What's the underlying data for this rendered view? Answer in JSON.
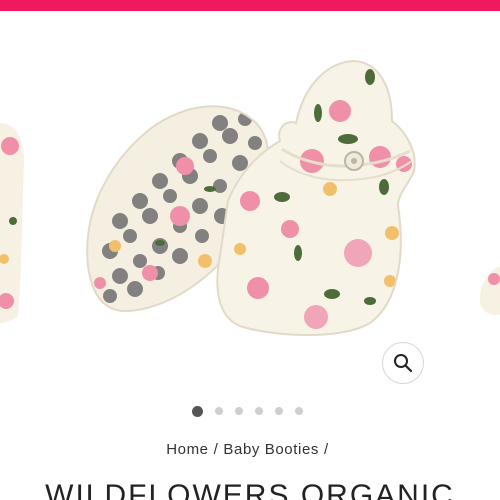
{
  "top_bar": {
    "color": "#f0185e"
  },
  "gallery": {
    "image_subject": "baby-booties-wildflowers",
    "zoom_icon": "search-icon",
    "slide_count": 6,
    "active_slide": 1
  },
  "breadcrumb": {
    "home": "Home",
    "sep1": "/",
    "category": "Baby Booties",
    "sep2": "/"
  },
  "product": {
    "title": "WILDFLOWERS ORGANIC"
  }
}
